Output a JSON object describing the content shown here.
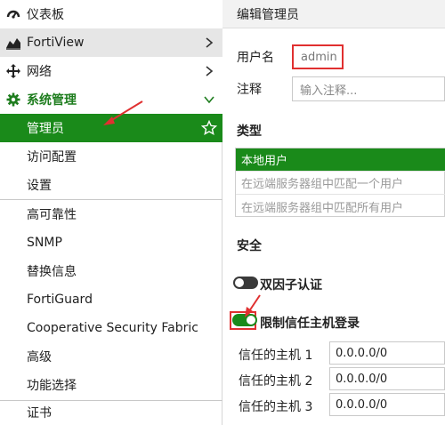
{
  "sidebar": {
    "items": [
      {
        "label": "仪表板",
        "icon": "dashboard-icon"
      },
      {
        "label": "FortiView",
        "icon": "chart-icon"
      },
      {
        "label": "网络",
        "icon": "move-arrows-icon"
      },
      {
        "label": "系统管理",
        "icon": "gear-icon"
      },
      {
        "label": "管理员"
      },
      {
        "label": "访问配置"
      },
      {
        "label": "设置"
      },
      {
        "label": "高可靠性"
      },
      {
        "label": "SNMP"
      },
      {
        "label": "替换信息"
      },
      {
        "label": "FortiGuard"
      },
      {
        "label": "Cooperative Security Fabric"
      },
      {
        "label": "高级"
      },
      {
        "label": "功能选择"
      },
      {
        "label": "证书"
      }
    ]
  },
  "editor": {
    "title": "编辑管理员",
    "username_label": "用户名",
    "username_value": "admin",
    "comment_label": "注释",
    "comment_placeholder": "输入注释...",
    "type_heading": "类型",
    "type_options": [
      "本地用户",
      "在远端服务器组中匹配一个用户",
      "在远端服务器组中匹配所有用户"
    ],
    "security_heading": "安全",
    "two_factor_label": "双因子认证",
    "trusted_host_label": "限制信任主机登录",
    "trusted_hosts": [
      {
        "label": "信任的主机 1",
        "value": "0.0.0.0/0"
      },
      {
        "label": "信任的主机 2",
        "value": "0.0.0.0/0"
      },
      {
        "label": "信任的主机 3",
        "value": "0.0.0.0/0"
      }
    ]
  },
  "colors": {
    "accent_green": "#1a8a1a",
    "highlight_red": "#e03030"
  }
}
